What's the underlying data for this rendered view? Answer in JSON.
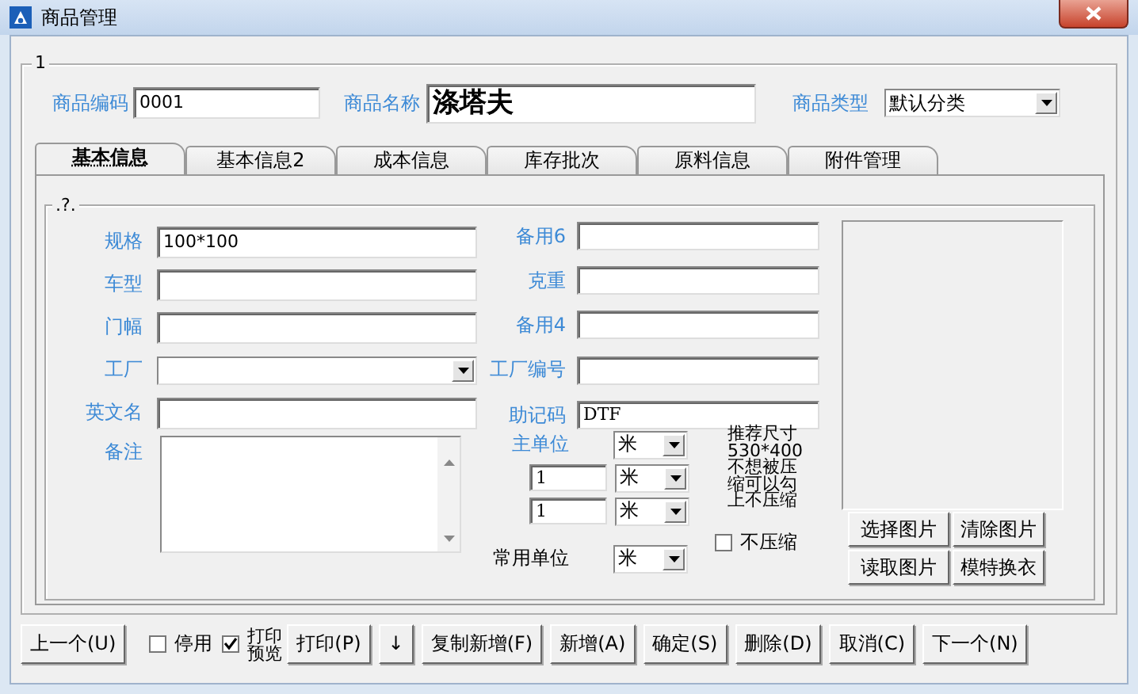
{
  "window": {
    "title": "商品管理"
  },
  "group_label": "1",
  "header_fields": [
    {
      "label": "商品编码",
      "value": "0001",
      "kind": "text"
    },
    {
      "label": "商品名称",
      "value": "涤塔夫",
      "kind": "large"
    },
    {
      "label": "商品类型",
      "value": "默认分类",
      "kind": "select"
    }
  ],
  "tabs": [
    {
      "label": "基本信息",
      "selected": true
    },
    {
      "label": "基本信息2",
      "selected": false
    },
    {
      "label": "成本信息",
      "selected": false
    },
    {
      "label": "库存批次",
      "selected": false
    },
    {
      "label": "原料信息",
      "selected": false
    },
    {
      "label": "附件管理",
      "selected": false
    }
  ],
  "panel_group_label": ".?.",
  "left_fields": [
    {
      "label": "规格",
      "value": "100*100",
      "kind": "text"
    },
    {
      "label": "车型",
      "kind": "text"
    },
    {
      "label": "门幅",
      "kind": "text"
    },
    {
      "label": "工厂",
      "kind": "select"
    },
    {
      "label": "英文名",
      "kind": "text"
    },
    {
      "label": "备注",
      "kind": "textarea"
    }
  ],
  "right_fields": [
    {
      "label": "备用6",
      "kind": "text"
    },
    {
      "label": "克重",
      "kind": "text"
    },
    {
      "label": "备用4",
      "kind": "text"
    },
    {
      "label": "工厂编号",
      "kind": "text"
    },
    {
      "label": "助记码",
      "value": "DTF",
      "kind": "text"
    }
  ],
  "units": {
    "main": {
      "label": "主单位",
      "value": "米"
    },
    "conversions": [
      {
        "value": "1",
        "unit": "米"
      },
      {
        "value": "1",
        "unit": "米"
      }
    ],
    "common": {
      "label": "常用单位",
      "value": "米"
    }
  },
  "image_note": "推荐尺寸530*400不想被压缩可以勾上不压缩",
  "no_compress": {
    "label": "不压缩",
    "checked": false
  },
  "image_buttons": [
    "选择图片",
    "清除图片",
    "读取图片",
    "模特换衣"
  ],
  "footer": [
    {
      "kind": "button",
      "label": "上一个(U)"
    },
    {
      "kind": "checkbox",
      "label": "停用",
      "checked": false
    },
    {
      "kind": "checkbox",
      "label": "打印预览",
      "checked": true
    },
    {
      "kind": "button",
      "label": "打印(P)"
    },
    {
      "kind": "button",
      "label": "↓"
    },
    {
      "kind": "button",
      "label": "复制新增(F)"
    },
    {
      "kind": "button",
      "label": "新增(A)"
    },
    {
      "kind": "button",
      "label": "确定(S)"
    },
    {
      "kind": "button",
      "label": "删除(D)"
    },
    {
      "kind": "button",
      "label": "取消(C)"
    },
    {
      "kind": "button",
      "label": "下一个(N)"
    }
  ]
}
